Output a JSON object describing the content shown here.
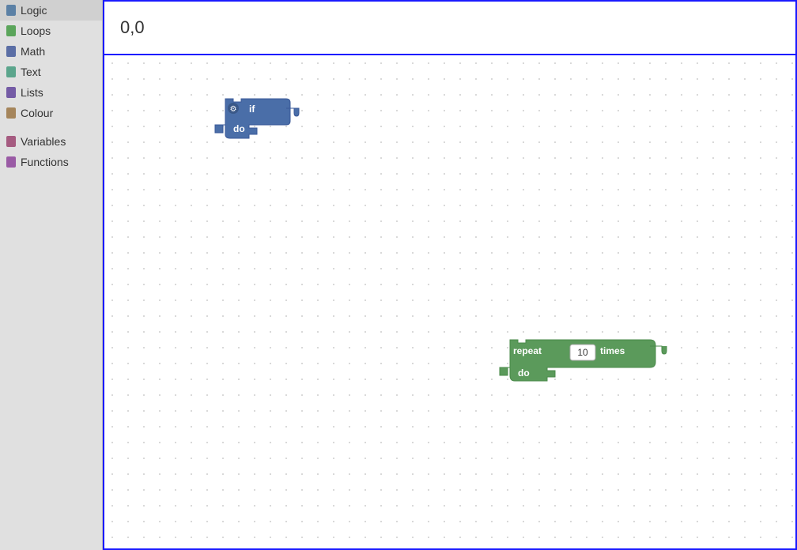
{
  "sidebar": {
    "items": [
      {
        "label": "Logic",
        "color": "#5b80a5"
      },
      {
        "label": "Loops",
        "color": "#5ba55b"
      },
      {
        "label": "Math",
        "color": "#5b80a5"
      },
      {
        "label": "Text",
        "color": "#5ba58c"
      },
      {
        "label": "Lists",
        "color": "#745ba5"
      },
      {
        "label": "Colour",
        "color": "#a5855b"
      },
      {
        "label": "Variables",
        "color": "#a55b80"
      },
      {
        "label": "Functions",
        "color": "#9a5ba5"
      }
    ]
  },
  "coords": {
    "display": "0,0"
  },
  "blocks": {
    "if_block": {
      "label_if": "if",
      "label_do": "do"
    },
    "repeat_block": {
      "label_repeat": "repeat",
      "label_times": "times",
      "label_do": "do",
      "value": "10"
    }
  }
}
